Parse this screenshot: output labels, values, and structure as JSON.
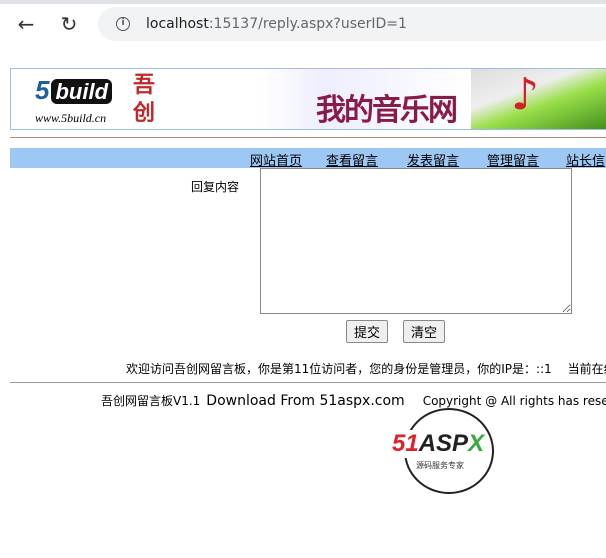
{
  "browser": {
    "url_host": "localhost",
    "url_rest": ":15137/reply.aspx?userID=1"
  },
  "banner": {
    "logo_text": "5",
    "logo_word": "build",
    "logo_url": "www.5build.cn",
    "logo_cn": "吾创",
    "music_title": "我的音乐网"
  },
  "nav": [
    "网站首页",
    "查看留言",
    "发表留言",
    "管理留言",
    "站长信"
  ],
  "form": {
    "label": "回复内容",
    "content": "",
    "submit": "提交",
    "clear": "清空"
  },
  "welcome": "欢迎访问吾创网留言板，你是第11位访问者，您的身份是管理员，你的IP是：::1　 当前在线",
  "footer": {
    "version": "吾创网留言板V1.1",
    "download": "Download From 51aspx.com",
    "copyright": "Copyright @ All rights has reserved"
  },
  "logo51": {
    "red": "51",
    "dark": "ASP",
    "green": "X",
    "sub": "源码服务专家"
  }
}
